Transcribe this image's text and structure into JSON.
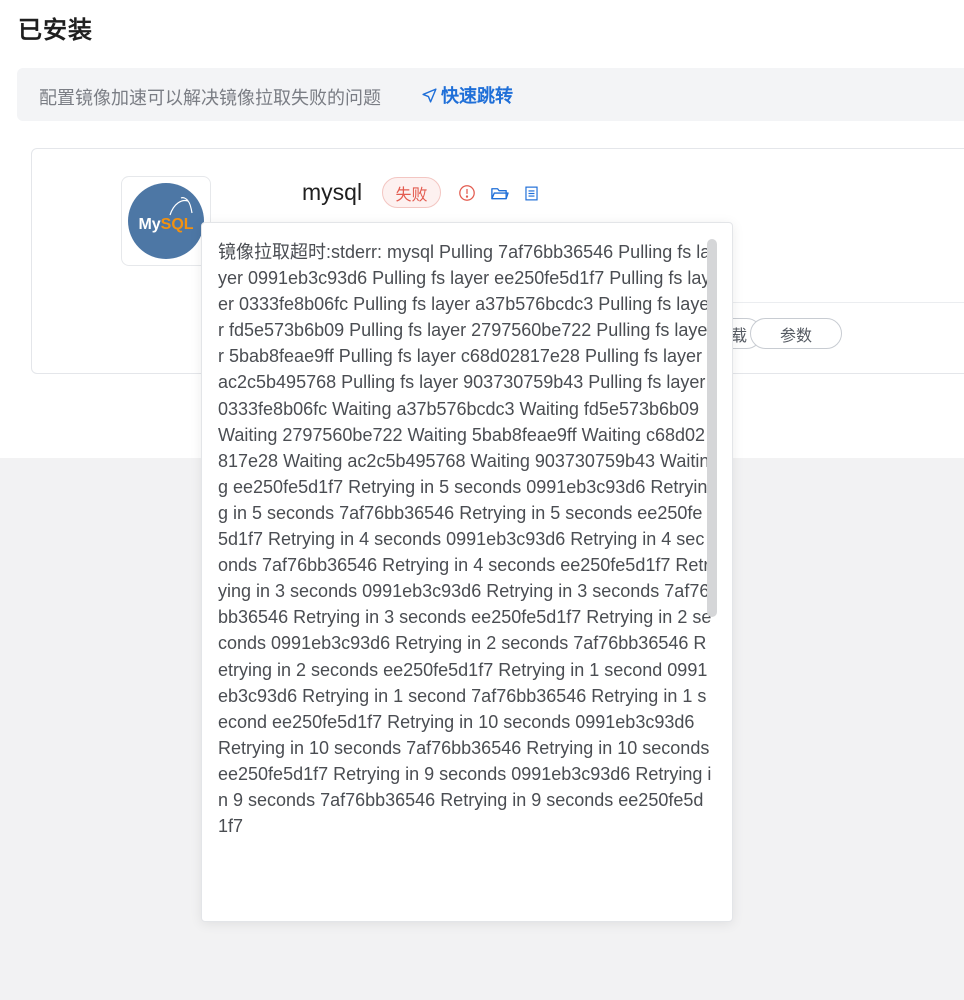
{
  "page": {
    "title": "已安装"
  },
  "notice": {
    "text": "配置镜像加速可以解决镜像拉取失败的问题",
    "link_label": "快速跳转",
    "link_icon": "send-icon"
  },
  "app": {
    "name": "mysql",
    "logo_text_a": "My",
    "logo_text_b": "SQL",
    "status": "失败",
    "status_color": "#e35b4f",
    "icons": [
      "alert-circle-icon",
      "folder-icon",
      "document-icon"
    ],
    "buttons": {
      "uninstall_partial": "载",
      "params": "参数"
    }
  },
  "popover": {
    "message": "镜像拉取超时:stderr: mysql Pulling 7af76bb36546 Pulling fs layer 0991eb3c93d6 Pulling fs layer ee250fe5d1f7 Pulling fs layer 0333fe8b06fc Pulling fs layer a37b576bcdc3 Pulling fs layer fd5e573b6b09 Pulling fs layer 2797560be722 Pulling fs layer 5bab8feae9ff Pulling fs layer c68d02817e28 Pulling fs layer ac2c5b495768 Pulling fs layer 903730759b43 Pulling fs layer 0333fe8b06fc Waiting a37b576bcdc3 Waiting fd5e573b6b09 Waiting 2797560be722 Waiting 5bab8feae9ff Waiting c68d02817e28 Waiting ac2c5b495768 Waiting 903730759b43 Waiting ee250fe5d1f7 Retrying in 5 seconds 0991eb3c93d6 Retrying in 5 seconds 7af76bb36546 Retrying in 5 seconds ee250fe5d1f7 Retrying in 4 seconds 0991eb3c93d6 Retrying in 4 seconds 7af76bb36546 Retrying in 4 seconds ee250fe5d1f7 Retrying in 3 seconds 0991eb3c93d6 Retrying in 3 seconds 7af76bb36546 Retrying in 3 seconds ee250fe5d1f7 Retrying in 2 seconds 0991eb3c93d6 Retrying in 2 seconds 7af76bb36546 Retrying in 2 seconds ee250fe5d1f7 Retrying in 1 second 0991eb3c93d6 Retrying in 1 second 7af76bb36546 Retrying in 1 second ee250fe5d1f7 Retrying in 10 seconds 0991eb3c93d6 Retrying in 10 seconds 7af76bb36546 Retrying in 10 seconds ee250fe5d1f7 Retrying in 9 seconds 0991eb3c93d6 Retrying in 9 seconds 7af76bb36546 Retrying in 9 seconds ee250fe5d1f7"
  },
  "colors": {
    "accent": "#1f6fd8",
    "error": "#e35b4f",
    "logo_bg": "#4d77a5"
  }
}
